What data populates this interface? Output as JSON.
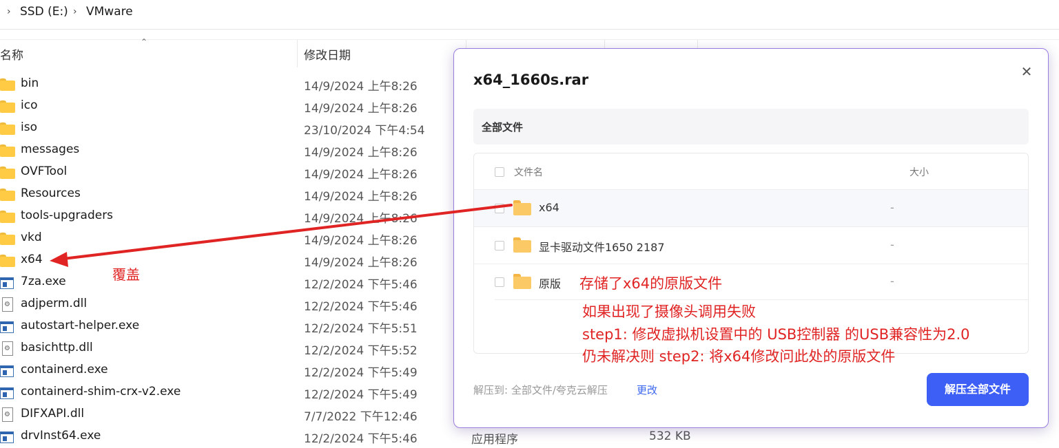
{
  "breadcrumb": {
    "items": [
      "SSD (E:)",
      "VMware"
    ]
  },
  "columns": {
    "name": "名称",
    "date": "修改日期"
  },
  "files": [
    {
      "name": "bin",
      "date": "14/9/2024 上午8:26",
      "icon": "folder-icon"
    },
    {
      "name": "ico",
      "date": "14/9/2024 上午8:26",
      "icon": "folder-icon"
    },
    {
      "name": "iso",
      "date": "23/10/2024 下午4:54",
      "icon": "folder-icon"
    },
    {
      "name": "messages",
      "date": "14/9/2024 上午8:26",
      "icon": "folder-icon"
    },
    {
      "name": "OVFTool",
      "date": "14/9/2024 上午8:26",
      "icon": "folder-icon"
    },
    {
      "name": "Resources",
      "date": "14/9/2024 上午8:26",
      "icon": "folder-icon"
    },
    {
      "name": "tools-upgraders",
      "date": "14/9/2024 上午8:26",
      "icon": "folder-icon"
    },
    {
      "name": "vkd",
      "date": "14/9/2024 上午8:26",
      "icon": "folder-icon"
    },
    {
      "name": "x64",
      "date": "14/9/2024 上午8:26",
      "icon": "folder-icon"
    },
    {
      "name": "7za.exe",
      "date": "12/2/2024 下午5:46",
      "icon": "exe-icon"
    },
    {
      "name": "adjperm.dll",
      "date": "12/2/2024 下午5:46",
      "icon": "dll-icon"
    },
    {
      "name": "autostart-helper.exe",
      "date": "12/2/2024 下午5:51",
      "icon": "exe-icon"
    },
    {
      "name": "basichttp.dll",
      "date": "12/2/2024 下午5:52",
      "icon": "dll-icon"
    },
    {
      "name": "containerd.exe",
      "date": "12/2/2024 下午5:49",
      "icon": "exe-icon"
    },
    {
      "name": "containerd-shim-crx-v2.exe",
      "date": "12/2/2024 下午5:49",
      "icon": "exe-icon"
    },
    {
      "name": "DIFXAPI.dll",
      "date": "7/7/2022 下午12:46",
      "icon": "dll-icon"
    },
    {
      "name": "drvInst64.exe",
      "date": "12/2/2024 下午5:46",
      "icon": "exe-icon"
    }
  ],
  "last_row_extra": {
    "type": "应用程序",
    "size": "532 KB"
  },
  "annotation_cover": "覆盖",
  "dialog": {
    "title": "x64_1660s.rar",
    "crumb": "全部文件",
    "header_name": "文件名",
    "header_size": "大小",
    "rows": [
      {
        "name": "x64",
        "size": "-"
      },
      {
        "name": "显卡驱动文件1650 2187",
        "size": "-"
      },
      {
        "name": "原版",
        "size": "-"
      }
    ],
    "footer_label": "解压到:  全部文件/夸克云解压",
    "footer_link": "更改",
    "extract_button": "解压全部文件"
  },
  "notes": {
    "line1": "存储了x64的原版文件",
    "line2": "如果出现了摄像头调用失败",
    "line3": "step1: 修改虚拟机设置中的 USB控制器 的USB兼容性为2.0",
    "line4": "仍未解决则 step2: 将x64修改问此处的原版文件"
  },
  "colors": {
    "accent": "#3d5ff5",
    "annotation": "#e02424",
    "folder": "#ffcb45"
  }
}
